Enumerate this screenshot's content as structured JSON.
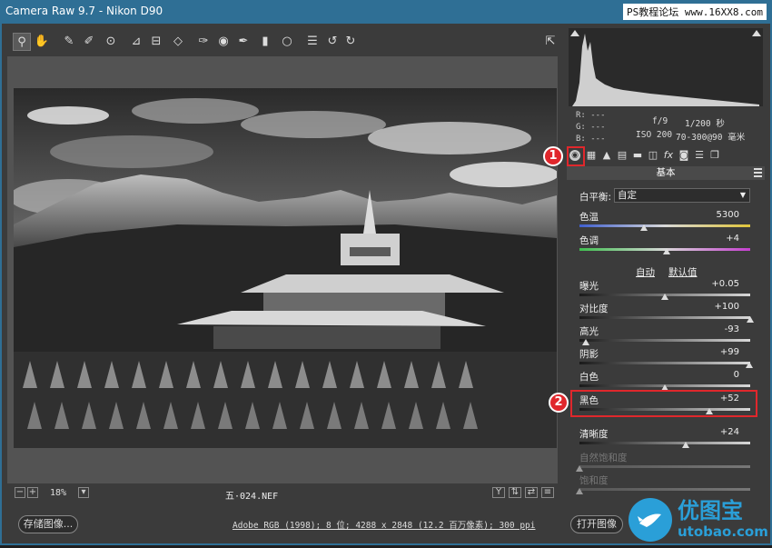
{
  "window": {
    "title": "Camera Raw 9.7 -  Nikon D90",
    "watermark": "PS教程论坛 www.16XX8.com"
  },
  "toolbar": {
    "tools": [
      {
        "name": "zoom-tool",
        "glyph": "⚲"
      },
      {
        "name": "hand-tool",
        "glyph": "✋"
      },
      {
        "name": "white-balance-tool",
        "glyph": "✎"
      },
      {
        "name": "color-sampler-tool",
        "glyph": "✐"
      },
      {
        "name": "targeted-adjustment-tool",
        "glyph": "⊙"
      },
      {
        "name": "crop-tool",
        "glyph": "⊿"
      },
      {
        "name": "straighten-tool",
        "glyph": "⊟"
      },
      {
        "name": "transform-tool",
        "glyph": "◇"
      },
      {
        "name": "spot-removal-tool",
        "glyph": "✑"
      },
      {
        "name": "red-eye-removal-tool",
        "glyph": "◉"
      },
      {
        "name": "adjustment-brush-tool",
        "glyph": "✒"
      },
      {
        "name": "graduated-filter-tool",
        "glyph": "▮"
      },
      {
        "name": "radial-filter-tool",
        "glyph": "○"
      },
      {
        "name": "preferences-tool",
        "glyph": "☰"
      },
      {
        "name": "rotate-left-tool",
        "glyph": "↺"
      },
      {
        "name": "rotate-right-tool",
        "glyph": "↻"
      }
    ],
    "fullscreen_glyph": "⇱"
  },
  "status": {
    "zoom_out": "−",
    "zoom_in": "+",
    "zoom_value": "18%",
    "filename": "五·024.NEF",
    "y_glyph": "Y"
  },
  "bottom": {
    "save_button": "存储图像...",
    "workflow_link": "Adobe RGB (1998); 8 位; 4288 x 2848 (12.2 百万像素); 300 ppi",
    "open_button": "打开图像"
  },
  "info": {
    "r_label": "R:",
    "g_label": "G:",
    "b_label": "B:",
    "dash": "---",
    "aperture": "f/9",
    "shutter": "1/200 秒",
    "iso": "ISO 200",
    "lens": "70-300@90 毫米"
  },
  "panel": {
    "title": "基本",
    "wb_label": "白平衡:",
    "wb_value": "自定",
    "auto_link": "自动",
    "default_link": "默认值",
    "sliders": [
      {
        "key": "temp",
        "label": "色温",
        "value": "5300",
        "pos": 0.38,
        "track": "temp",
        "dim": false
      },
      {
        "key": "tint",
        "label": "色调",
        "value": "+4",
        "pos": 0.51,
        "track": "tint",
        "dim": false
      },
      {
        "key": "exposure",
        "label": "曝光",
        "value": "+0.05",
        "pos": 0.5,
        "track": "plain",
        "dim": false
      },
      {
        "key": "contrast",
        "label": "对比度",
        "value": "+100",
        "pos": 1.0,
        "track": "plain",
        "dim": false
      },
      {
        "key": "highlights",
        "label": "高光",
        "value": "-93",
        "pos": 0.035,
        "track": "plain",
        "dim": false
      },
      {
        "key": "shadows",
        "label": "阴影",
        "value": "+99",
        "pos": 0.995,
        "track": "plain",
        "dim": false
      },
      {
        "key": "whites",
        "label": "白色",
        "value": "0",
        "pos": 0.5,
        "track": "plain",
        "dim": false
      },
      {
        "key": "blacks",
        "label": "黑色",
        "value": "+52",
        "pos": 0.76,
        "track": "plain",
        "dim": false
      },
      {
        "key": "clarity",
        "label": "清晰度",
        "value": "+24",
        "pos": 0.62,
        "track": "plain",
        "dim": false
      },
      {
        "key": "vibrance",
        "label": "自然饱和度",
        "value": "",
        "pos": 0.0,
        "track": "plain",
        "dim": true
      },
      {
        "key": "saturation",
        "label": "饱和度",
        "value": "",
        "pos": 0.0,
        "track": "plain",
        "dim": true
      }
    ]
  },
  "annotations": {
    "badge1": "1",
    "badge2": "2",
    "accent_color": "#e0272c"
  },
  "logo": {
    "text": "优图宝",
    "url": "utobao.com",
    "color": "#2a9fd8"
  }
}
